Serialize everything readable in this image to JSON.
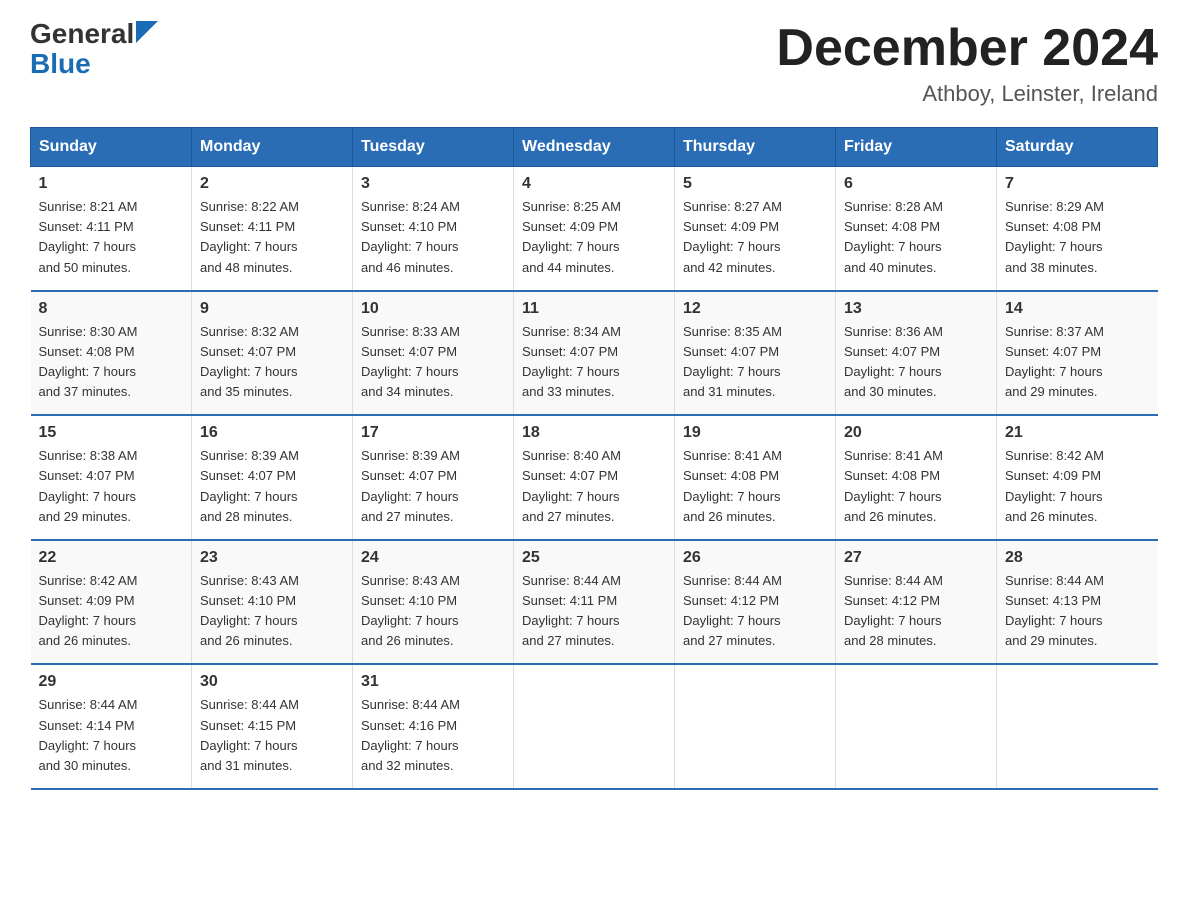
{
  "header": {
    "logo_general": "General",
    "logo_blue": "Blue",
    "month_year": "December 2024",
    "location": "Athboy, Leinster, Ireland"
  },
  "days_of_week": [
    "Sunday",
    "Monday",
    "Tuesday",
    "Wednesday",
    "Thursday",
    "Friday",
    "Saturday"
  ],
  "weeks": [
    [
      {
        "num": "1",
        "sunrise": "8:21 AM",
        "sunset": "4:11 PM",
        "daylight": "7 hours and 50 minutes."
      },
      {
        "num": "2",
        "sunrise": "8:22 AM",
        "sunset": "4:11 PM",
        "daylight": "7 hours and 48 minutes."
      },
      {
        "num": "3",
        "sunrise": "8:24 AM",
        "sunset": "4:10 PM",
        "daylight": "7 hours and 46 minutes."
      },
      {
        "num": "4",
        "sunrise": "8:25 AM",
        "sunset": "4:09 PM",
        "daylight": "7 hours and 44 minutes."
      },
      {
        "num": "5",
        "sunrise": "8:27 AM",
        "sunset": "4:09 PM",
        "daylight": "7 hours and 42 minutes."
      },
      {
        "num": "6",
        "sunrise": "8:28 AM",
        "sunset": "4:08 PM",
        "daylight": "7 hours and 40 minutes."
      },
      {
        "num": "7",
        "sunrise": "8:29 AM",
        "sunset": "4:08 PM",
        "daylight": "7 hours and 38 minutes."
      }
    ],
    [
      {
        "num": "8",
        "sunrise": "8:30 AM",
        "sunset": "4:08 PM",
        "daylight": "7 hours and 37 minutes."
      },
      {
        "num": "9",
        "sunrise": "8:32 AM",
        "sunset": "4:07 PM",
        "daylight": "7 hours and 35 minutes."
      },
      {
        "num": "10",
        "sunrise": "8:33 AM",
        "sunset": "4:07 PM",
        "daylight": "7 hours and 34 minutes."
      },
      {
        "num": "11",
        "sunrise": "8:34 AM",
        "sunset": "4:07 PM",
        "daylight": "7 hours and 33 minutes."
      },
      {
        "num": "12",
        "sunrise": "8:35 AM",
        "sunset": "4:07 PM",
        "daylight": "7 hours and 31 minutes."
      },
      {
        "num": "13",
        "sunrise": "8:36 AM",
        "sunset": "4:07 PM",
        "daylight": "7 hours and 30 minutes."
      },
      {
        "num": "14",
        "sunrise": "8:37 AM",
        "sunset": "4:07 PM",
        "daylight": "7 hours and 29 minutes."
      }
    ],
    [
      {
        "num": "15",
        "sunrise": "8:38 AM",
        "sunset": "4:07 PM",
        "daylight": "7 hours and 29 minutes."
      },
      {
        "num": "16",
        "sunrise": "8:39 AM",
        "sunset": "4:07 PM",
        "daylight": "7 hours and 28 minutes."
      },
      {
        "num": "17",
        "sunrise": "8:39 AM",
        "sunset": "4:07 PM",
        "daylight": "7 hours and 27 minutes."
      },
      {
        "num": "18",
        "sunrise": "8:40 AM",
        "sunset": "4:07 PM",
        "daylight": "7 hours and 27 minutes."
      },
      {
        "num": "19",
        "sunrise": "8:41 AM",
        "sunset": "4:08 PM",
        "daylight": "7 hours and 26 minutes."
      },
      {
        "num": "20",
        "sunrise": "8:41 AM",
        "sunset": "4:08 PM",
        "daylight": "7 hours and 26 minutes."
      },
      {
        "num": "21",
        "sunrise": "8:42 AM",
        "sunset": "4:09 PM",
        "daylight": "7 hours and 26 minutes."
      }
    ],
    [
      {
        "num": "22",
        "sunrise": "8:42 AM",
        "sunset": "4:09 PM",
        "daylight": "7 hours and 26 minutes."
      },
      {
        "num": "23",
        "sunrise": "8:43 AM",
        "sunset": "4:10 PM",
        "daylight": "7 hours and 26 minutes."
      },
      {
        "num": "24",
        "sunrise": "8:43 AM",
        "sunset": "4:10 PM",
        "daylight": "7 hours and 26 minutes."
      },
      {
        "num": "25",
        "sunrise": "8:44 AM",
        "sunset": "4:11 PM",
        "daylight": "7 hours and 27 minutes."
      },
      {
        "num": "26",
        "sunrise": "8:44 AM",
        "sunset": "4:12 PM",
        "daylight": "7 hours and 27 minutes."
      },
      {
        "num": "27",
        "sunrise": "8:44 AM",
        "sunset": "4:12 PM",
        "daylight": "7 hours and 28 minutes."
      },
      {
        "num": "28",
        "sunrise": "8:44 AM",
        "sunset": "4:13 PM",
        "daylight": "7 hours and 29 minutes."
      }
    ],
    [
      {
        "num": "29",
        "sunrise": "8:44 AM",
        "sunset": "4:14 PM",
        "daylight": "7 hours and 30 minutes."
      },
      {
        "num": "30",
        "sunrise": "8:44 AM",
        "sunset": "4:15 PM",
        "daylight": "7 hours and 31 minutes."
      },
      {
        "num": "31",
        "sunrise": "8:44 AM",
        "sunset": "4:16 PM",
        "daylight": "7 hours and 32 minutes."
      },
      null,
      null,
      null,
      null
    ]
  ]
}
